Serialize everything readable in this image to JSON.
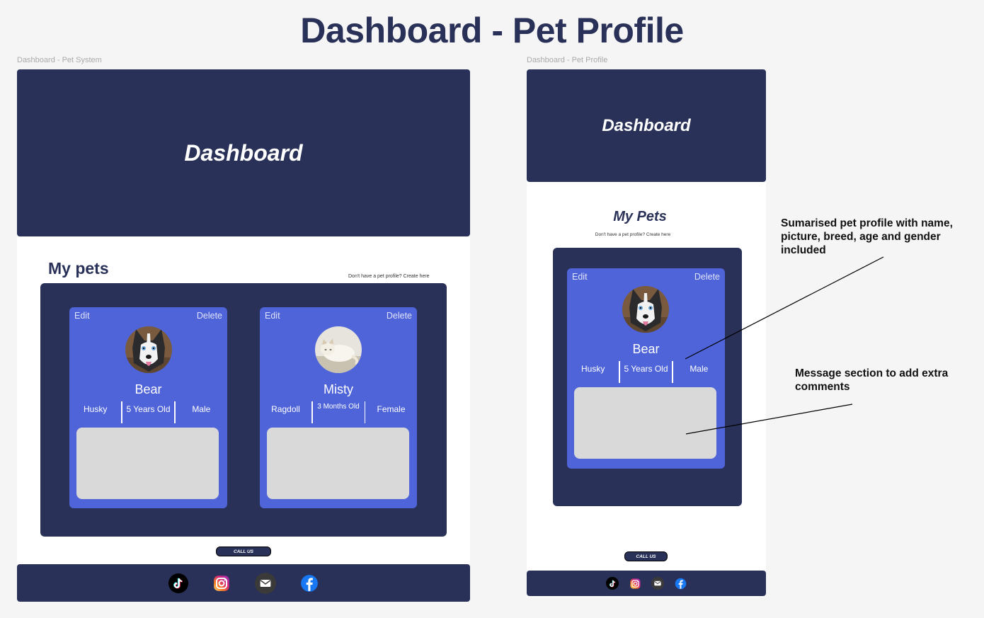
{
  "page_title": "Dashboard - Pet Profile",
  "frames": {
    "desktop_label": "Dashboard - Pet System",
    "mobile_label": "Dashboard - Pet Profile"
  },
  "desktop": {
    "header_title": "Dashboard",
    "pets_heading": "My pets",
    "create_link": "Don't have a pet profile? Create here",
    "call_button": "CALL US"
  },
  "mobile": {
    "header_title": "Dashboard",
    "pets_heading": "My Pets",
    "create_link": "Don't have a pet profile? Create here",
    "call_button": "CALL US"
  },
  "card_actions": {
    "edit": "Edit",
    "delete": "Delete"
  },
  "pets": [
    {
      "name": "Bear",
      "breed": "Husky",
      "age": "5 Years Old",
      "gender": "Male",
      "avatar": "husky-photo"
    },
    {
      "name": "Misty",
      "breed": "Ragdoll",
      "age": "3 Months Old",
      "gender": "Female",
      "avatar": "ragdoll-photo"
    }
  ],
  "footer_icons": [
    "tiktok-icon",
    "instagram-icon",
    "email-icon",
    "facebook-icon"
  ],
  "annotations": {
    "profile": "Sumarised pet profile with name, picture, breed, age and gender included",
    "message": "Message section to add extra comments"
  },
  "colors": {
    "navy": "#2a3158",
    "card_blue": "#4f64d8",
    "message_grey": "#d9d9d9",
    "page_bg": "#f5f5f5"
  }
}
